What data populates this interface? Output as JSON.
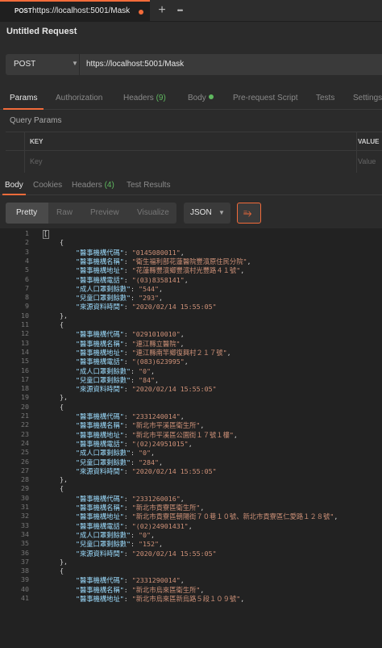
{
  "tab": {
    "method": "POST",
    "url": "https://localhost:5001/Mask"
  },
  "window": {
    "new_tab": "+",
    "more": "•••"
  },
  "request": {
    "title": "Untitled Request",
    "method": "POST",
    "url": "https://localhost:5001/Mask"
  },
  "request_tabs": {
    "params": "Params",
    "authorization": "Authorization",
    "headers": "Headers",
    "headers_count": "(9)",
    "body": "Body",
    "prerequest": "Pre-request Script",
    "tests": "Tests",
    "settings": "Settings"
  },
  "query_params": {
    "title": "Query Params",
    "key_header": "KEY",
    "value_header": "VALUE",
    "key_placeholder": "Key",
    "value_placeholder": "Value"
  },
  "response_tabs": {
    "body": "Body",
    "cookies": "Cookies",
    "headers": "Headers",
    "headers_count": "(4)",
    "test_results": "Test Results"
  },
  "view": {
    "pretty": "Pretty",
    "raw": "Raw",
    "preview": "Preview",
    "visualize": "Visualize",
    "format": "JSON"
  },
  "colors": {
    "accent": "#f26b3a",
    "key": "#9cdcfe",
    "string": "#ce9178",
    "count": "#5fb85f"
  },
  "code_lines": [
    {
      "n": "1",
      "i": "",
      "p": "[",
      "k": "",
      "s": ""
    },
    {
      "n": "2",
      "i": "    ",
      "p": "{",
      "k": "",
      "s": ""
    },
    {
      "n": "3",
      "i": "        ",
      "p": "",
      "k": "\"醫事機構代碼\"",
      "s": "\"0145080011\"",
      "c": ","
    },
    {
      "n": "4",
      "i": "        ",
      "p": "",
      "k": "\"醫事機構名稱\"",
      "s": "\"衛生福利部花蓮醫院豐濱原住民分院\"",
      "c": ","
    },
    {
      "n": "5",
      "i": "        ",
      "p": "",
      "k": "\"醫事機構地址\"",
      "s": "\"花蓮縣豐濱鄉豐濱村光豐路４１號\"",
      "c": ","
    },
    {
      "n": "6",
      "i": "        ",
      "p": "",
      "k": "\"醫事機構電話\"",
      "s": "\"(03)8358141\"",
      "c": ","
    },
    {
      "n": "7",
      "i": "        ",
      "p": "",
      "k": "\"成人口罩剩餘數\"",
      "s": "\"544\"",
      "c": ","
    },
    {
      "n": "8",
      "i": "        ",
      "p": "",
      "k": "\"兒童口罩剩餘數\"",
      "s": "\"293\"",
      "c": ","
    },
    {
      "n": "9",
      "i": "        ",
      "p": "",
      "k": "\"來源資料時間\"",
      "s": "\"2020/02/14 15:55:05\"",
      "c": ""
    },
    {
      "n": "10",
      "i": "    ",
      "p": "},",
      "k": "",
      "s": ""
    },
    {
      "n": "11",
      "i": "    ",
      "p": "{",
      "k": "",
      "s": ""
    },
    {
      "n": "12",
      "i": "        ",
      "p": "",
      "k": "\"醫事機構代碼\"",
      "s": "\"0291010010\"",
      "c": ","
    },
    {
      "n": "13",
      "i": "        ",
      "p": "",
      "k": "\"醫事機構名稱\"",
      "s": "\"連江縣立醫院\"",
      "c": ","
    },
    {
      "n": "14",
      "i": "        ",
      "p": "",
      "k": "\"醫事機構地址\"",
      "s": "\"連江縣南竿鄉復興村２１７號\"",
      "c": ","
    },
    {
      "n": "15",
      "i": "        ",
      "p": "",
      "k": "\"醫事機構電話\"",
      "s": "\"(083)623995\"",
      "c": ","
    },
    {
      "n": "16",
      "i": "        ",
      "p": "",
      "k": "\"成人口罩剩餘數\"",
      "s": "\"0\"",
      "c": ","
    },
    {
      "n": "17",
      "i": "        ",
      "p": "",
      "k": "\"兒童口罩剩餘數\"",
      "s": "\"84\"",
      "c": ","
    },
    {
      "n": "18",
      "i": "        ",
      "p": "",
      "k": "\"來源資料時間\"",
      "s": "\"2020/02/14 15:55:05\"",
      "c": ""
    },
    {
      "n": "19",
      "i": "    ",
      "p": "},",
      "k": "",
      "s": ""
    },
    {
      "n": "20",
      "i": "    ",
      "p": "{",
      "k": "",
      "s": ""
    },
    {
      "n": "21",
      "i": "        ",
      "p": "",
      "k": "\"醫事機構代碼\"",
      "s": "\"2331240014\"",
      "c": ","
    },
    {
      "n": "22",
      "i": "        ",
      "p": "",
      "k": "\"醫事機構名稱\"",
      "s": "\"新北市平溪區衛生所\"",
      "c": ","
    },
    {
      "n": "23",
      "i": "        ",
      "p": "",
      "k": "\"醫事機構地址\"",
      "s": "\"新北市平溪區公園街１７號１樓\"",
      "c": ","
    },
    {
      "n": "24",
      "i": "        ",
      "p": "",
      "k": "\"醫事機構電話\"",
      "s": "\"(02)24951015\"",
      "c": ","
    },
    {
      "n": "25",
      "i": "        ",
      "p": "",
      "k": "\"成人口罩剩餘數\"",
      "s": "\"0\"",
      "c": ","
    },
    {
      "n": "26",
      "i": "        ",
      "p": "",
      "k": "\"兒童口罩剩餘數\"",
      "s": "\"284\"",
      "c": ","
    },
    {
      "n": "27",
      "i": "        ",
      "p": "",
      "k": "\"來源資料時間\"",
      "s": "\"2020/02/14 15:55:05\"",
      "c": ""
    },
    {
      "n": "28",
      "i": "    ",
      "p": "},",
      "k": "",
      "s": ""
    },
    {
      "n": "29",
      "i": "    ",
      "p": "{",
      "k": "",
      "s": ""
    },
    {
      "n": "30",
      "i": "        ",
      "p": "",
      "k": "\"醫事機構代碼\"",
      "s": "\"2331260016\"",
      "c": ","
    },
    {
      "n": "31",
      "i": "        ",
      "p": "",
      "k": "\"醫事機構名稱\"",
      "s": "\"新北市貢寮區衛生所\"",
      "c": ","
    },
    {
      "n": "32",
      "i": "        ",
      "p": "",
      "k": "\"醫事機構地址\"",
      "s": "\"新北市貢寮區朝陽街７０巷１０號、新北市貢寮區仁愛路１２８號\"",
      "c": ","
    },
    {
      "n": "33",
      "i": "        ",
      "p": "",
      "k": "\"醫事機構電話\"",
      "s": "\"(02)24901431\"",
      "c": ","
    },
    {
      "n": "34",
      "i": "        ",
      "p": "",
      "k": "\"成人口罩剩餘數\"",
      "s": "\"0\"",
      "c": ","
    },
    {
      "n": "35",
      "i": "        ",
      "p": "",
      "k": "\"兒童口罩剩餘數\"",
      "s": "\"152\"",
      "c": ","
    },
    {
      "n": "36",
      "i": "        ",
      "p": "",
      "k": "\"來源資料時間\"",
      "s": "\"2020/02/14 15:55:05\"",
      "c": ""
    },
    {
      "n": "37",
      "i": "    ",
      "p": "},",
      "k": "",
      "s": ""
    },
    {
      "n": "38",
      "i": "    ",
      "p": "{",
      "k": "",
      "s": ""
    },
    {
      "n": "39",
      "i": "        ",
      "p": "",
      "k": "\"醫事機構代碼\"",
      "s": "\"2331290014\"",
      "c": ","
    },
    {
      "n": "40",
      "i": "        ",
      "p": "",
      "k": "\"醫事機構名稱\"",
      "s": "\"新北市烏來區衛生所\"",
      "c": ","
    },
    {
      "n": "41",
      "i": "        ",
      "p": "",
      "k": "\"醫事機構地址\"",
      "s": "\"新北市烏來區新烏路５段１０９號\"",
      "c": ","
    }
  ]
}
